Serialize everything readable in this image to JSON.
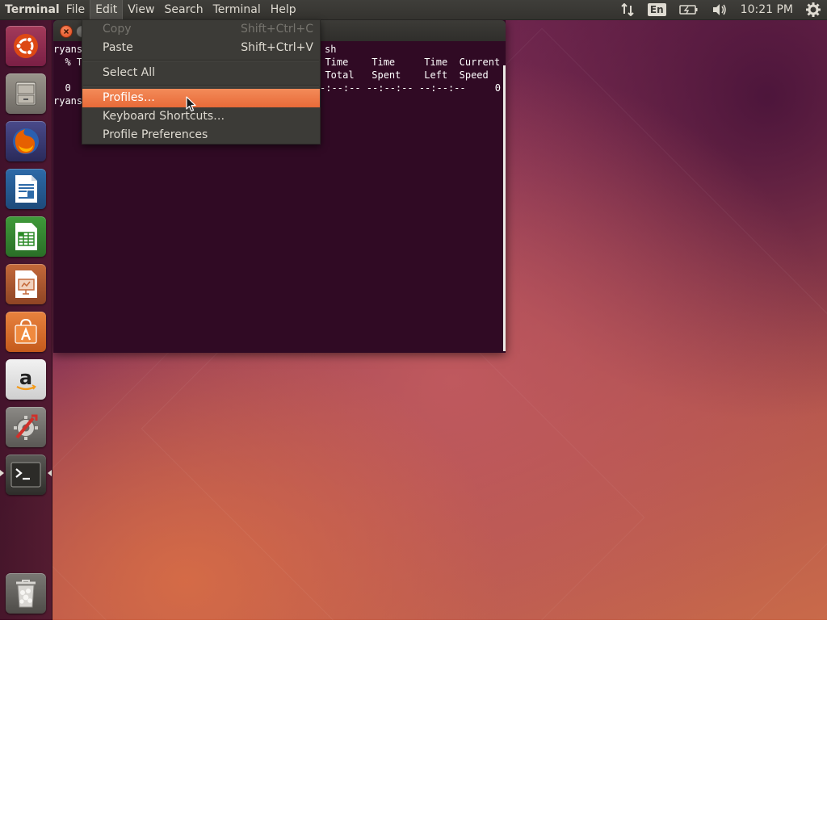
{
  "top_panel": {
    "app_title": "Terminal",
    "menus": [
      "File",
      "Edit",
      "View",
      "Search",
      "Terminal",
      "Help"
    ],
    "language": "En",
    "clock": "10:21 PM",
    "icons": [
      "network-icon",
      "battery-icon",
      "volume-icon",
      "settings-gear-icon"
    ]
  },
  "launcher": {
    "items": [
      {
        "name": "Dash Home",
        "icon": "ubuntu-logo-icon"
      },
      {
        "name": "Files",
        "icon": "file-cabinet-icon"
      },
      {
        "name": "Firefox Web Browser",
        "icon": "firefox-icon"
      },
      {
        "name": "LibreOffice Writer",
        "icon": "writer-document-icon"
      },
      {
        "name": "LibreOffice Calc",
        "icon": "calc-spreadsheet-icon"
      },
      {
        "name": "LibreOffice Impress",
        "icon": "impress-presentation-icon"
      },
      {
        "name": "Ubuntu Software Center",
        "icon": "software-center-bag-icon"
      },
      {
        "name": "Amazon",
        "icon": "amazon-icon"
      },
      {
        "name": "System Settings",
        "icon": "system-settings-icon"
      },
      {
        "name": "Terminal",
        "icon": "terminal-icon"
      },
      {
        "name": "Trash",
        "icon": "trash-icon"
      }
    ]
  },
  "terminal": {
    "lines": [
      {
        "text": "ryans",
        "col": 0,
        "row": 0
      },
      {
        "text": "sh",
        "col": 336,
        "row": 0
      },
      {
        "text": "  % T",
        "col": 0,
        "row": 1
      },
      {
        "text": "  Time    Time     Time  Current",
        "col": 336,
        "row": 1
      },
      {
        "text": "  Total   Spent    Left  Speed",
        "col": 336,
        "row": 2
      },
      {
        "text": "  0",
        "col": 0,
        "row": 3
      },
      {
        "text": "-:--:-- --:--:-- --:--:--     0",
        "col": 330,
        "row": 3
      },
      {
        "text": "ryans",
        "col": 0,
        "row": 4
      }
    ]
  },
  "edit_menu": {
    "items": [
      {
        "label": "Copy",
        "accel": "Shift+Ctrl+C",
        "disabled": true
      },
      {
        "label": "Paste",
        "accel": "Shift+Ctrl+V",
        "disabled": false
      },
      {
        "label": "Select All",
        "accel": "",
        "disabled": false
      },
      {
        "label": "Profiles…",
        "accel": "",
        "disabled": false,
        "selected": true
      },
      {
        "label": "Keyboard Shortcuts…",
        "accel": "",
        "disabled": false
      },
      {
        "label": "Profile Preferences",
        "accel": "",
        "disabled": false
      }
    ]
  },
  "colors": {
    "terminal_bg": "#300a24",
    "panel_bg": "#3c3b37",
    "highlight": "#e95420"
  }
}
